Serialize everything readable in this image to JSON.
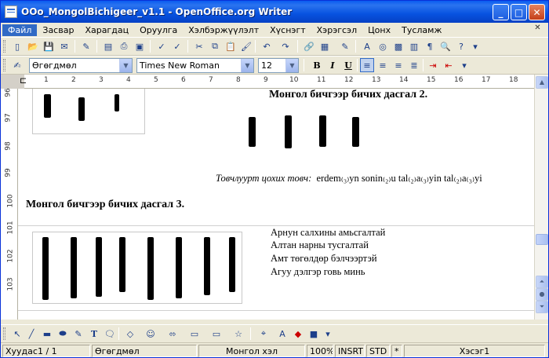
{
  "window": {
    "title": "OOo_MongolBichigeer_v1.1 - OpenOffice.org Writer"
  },
  "menu": {
    "items": [
      "Файл",
      "Засвар",
      "Харагдац",
      "Оруулга",
      "Хэлбэржүүлэлт",
      "Хүснэгт",
      "Хэрэгсэл",
      "Цонх",
      "Тусламж"
    ],
    "active": "Файл"
  },
  "format_toolbar": {
    "style_value": "Өгөгдмөл",
    "font_value": "Times New Roman",
    "size_value": "12",
    "bold_label": "B",
    "italic_label": "I",
    "underline_label": "U"
  },
  "ruler": {
    "marks": [
      "1",
      "2",
      "3",
      "4",
      "5",
      "6",
      "7",
      "8",
      "9",
      "10",
      "11",
      "12",
      "13",
      "14",
      "15",
      "16",
      "17",
      "18"
    ]
  },
  "vruler": {
    "marks": [
      "96",
      "97",
      "98",
      "99",
      "100",
      "101",
      "102",
      "103"
    ]
  },
  "document": {
    "exercise2_title": "Монгол бичгээр бичих дасгал 2.",
    "exercise3_title": "Монгол бичгээр бичих дасгал 3.",
    "hint_label": "Товчлуурт цохих товч:",
    "hint_text": "erdem₍₃₎yn sonin₍₂₎u tal₍₂₎a₍₃₎yin tal₍₂₎a₍₃₎yi",
    "poem_lines": [
      "Арнун салхины амьсгалтай",
      "Алтан нарны тусгалтай",
      "Амт төгөлдөр бэлчээртэй",
      "Агуу дэлгэр говь минь"
    ]
  },
  "status": {
    "page": "Хуудас1 / 1",
    "style": "Өгөгдмөл",
    "language": "Монгол хэл",
    "zoom": "100%",
    "insert_mode": "INSRT",
    "selection_mode": "STD",
    "modified": "*",
    "section": "Хэсэг1"
  }
}
